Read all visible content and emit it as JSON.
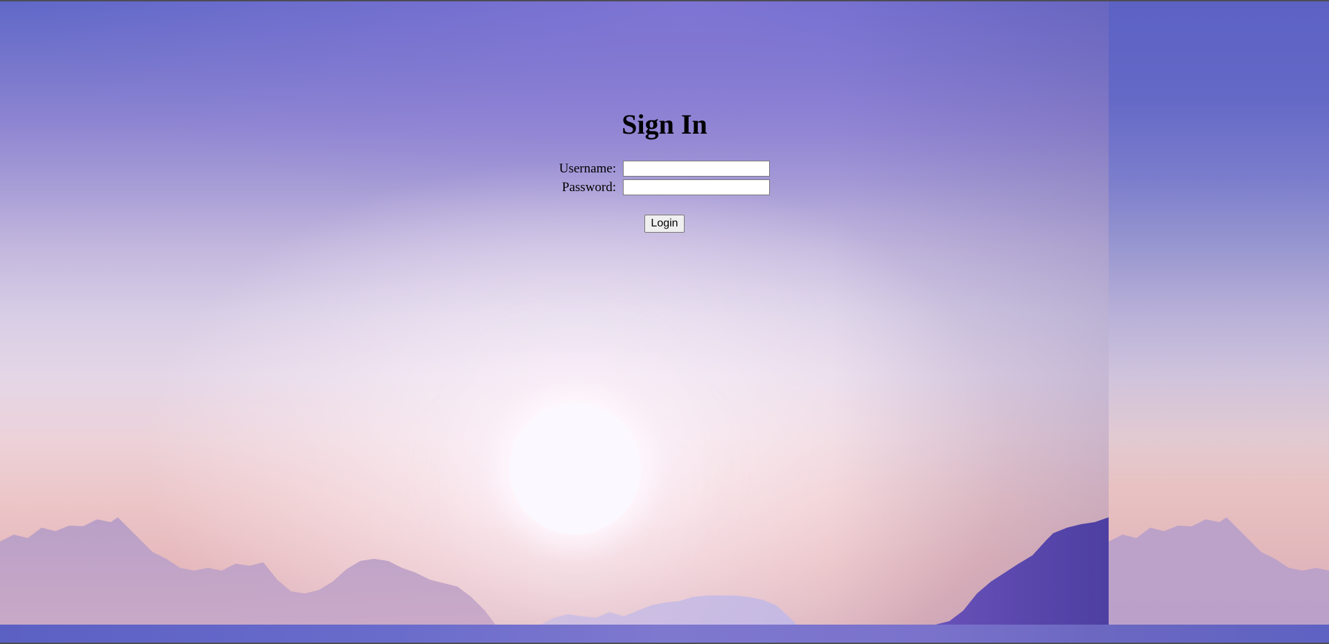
{
  "login": {
    "title": "Sign In",
    "username_label": "Username:",
    "username_value": "",
    "password_label": "Password:",
    "password_value": "",
    "submit_label": "Login"
  },
  "colors": {
    "sky_top": "#6068c8",
    "sky_bottom": "#dbb0ba",
    "mountain_dark": "#4e3aa8",
    "mountain_light": "#c8bde6"
  }
}
